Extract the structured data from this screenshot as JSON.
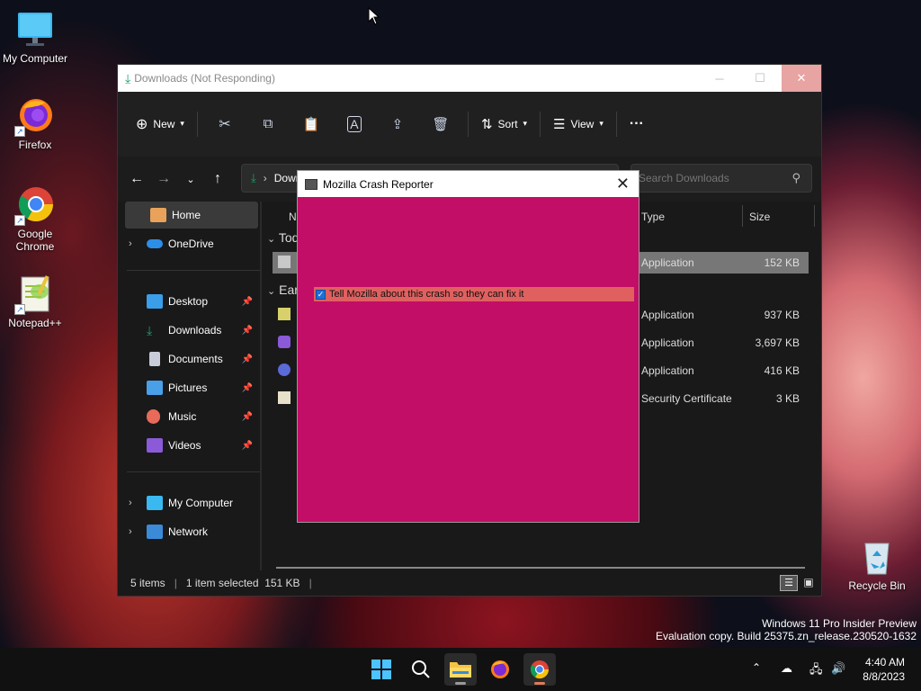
{
  "desktop": {
    "icons": [
      {
        "label": "My Computer"
      },
      {
        "label": "Firefox"
      },
      {
        "label": "Google Chrome"
      },
      {
        "label": "Notepad++"
      },
      {
        "label": "Recycle Bin"
      }
    ],
    "watermark": {
      "line1": "Windows 11 Pro Insider Preview",
      "line2": "Evaluation copy. Build 25375.zn_release.230520-1632"
    }
  },
  "explorer": {
    "title": "Downloads (Not Responding)",
    "toolbar": {
      "new_label": "New",
      "sort_label": "Sort",
      "view_label": "View",
      "more_label": "···"
    },
    "address": {
      "path": "Downloads",
      "separator": "›"
    },
    "search": {
      "placeholder": "Search Downloads"
    },
    "sidebar": {
      "items": [
        {
          "label": "Home"
        },
        {
          "label": "OneDrive"
        },
        {
          "label": "Desktop"
        },
        {
          "label": "Downloads"
        },
        {
          "label": "Documents"
        },
        {
          "label": "Pictures"
        },
        {
          "label": "Music"
        },
        {
          "label": "Videos"
        },
        {
          "label": "My Computer"
        },
        {
          "label": "Network"
        }
      ]
    },
    "columns": {
      "name": "Name",
      "type": "Type",
      "size": "Size"
    },
    "groups": {
      "today": "Today",
      "earlier": "Earlier"
    },
    "rows": [
      {
        "type": "Application",
        "size": "152 KB"
      },
      {
        "type": "Application",
        "size": "937 KB"
      },
      {
        "type": "Application",
        "size": "3,697 KB"
      },
      {
        "type": "Application",
        "size": "416 KB"
      },
      {
        "type": "Security Certificate",
        "size": "3 KB"
      }
    ],
    "status": {
      "items": "5 items",
      "selected": "1 item selected  151 KB"
    }
  },
  "crash_reporter": {
    "title": "Mozilla Crash Reporter",
    "checkbox_label": "Tell Mozilla about this crash so they can fix it",
    "checked": true
  },
  "taskbar": {
    "time": "4:40 AM",
    "date": "8/8/2023"
  }
}
